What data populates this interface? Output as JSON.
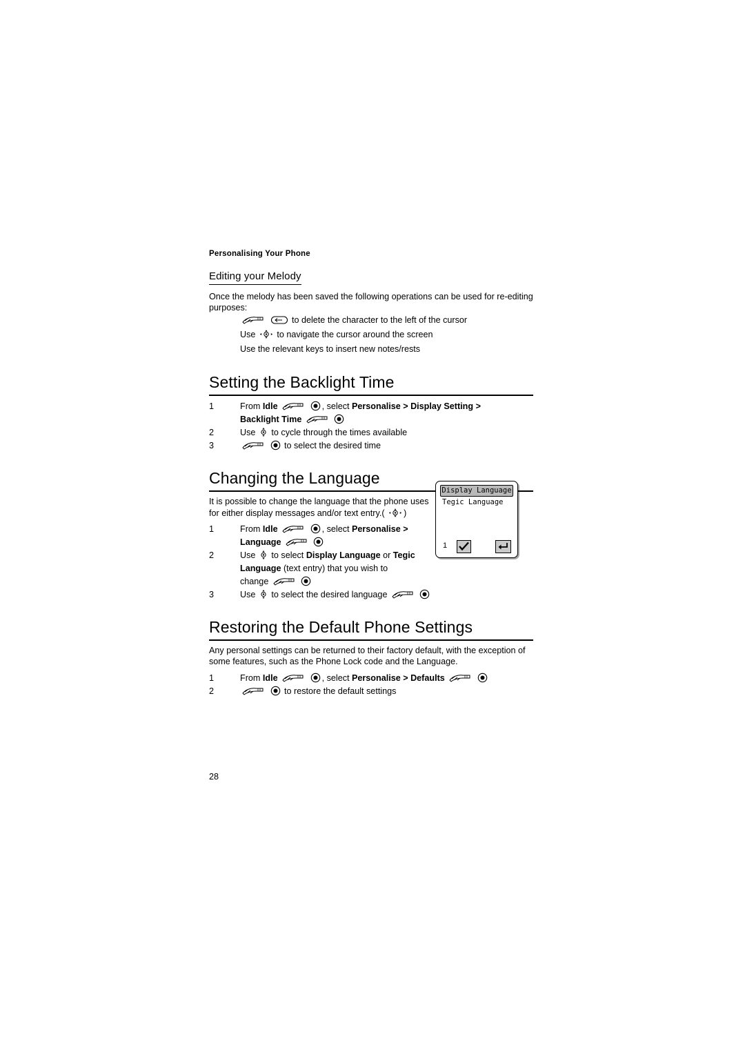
{
  "running_head": "Personalising Your Phone",
  "sections": [
    {
      "id": "editing-melody",
      "heading": "Editing your Melody",
      "intro": "Once the melody has been saved the following operations can be used for re-editing purposes:",
      "lines": [
        "to delete the character to the left of the cursor",
        "Use",
        "to navigate the cursor around the screen",
        "Use the relevant keys to insert new notes/rests"
      ]
    },
    {
      "id": "backlight-time",
      "heading": "Setting the Backlight Time",
      "steps": [
        {
          "num": "1",
          "parts": [
            "From ",
            "Idle",
            ", select ",
            "Personalise",
            " > ",
            "Display Setting",
            " > ",
            "Backlight Time"
          ]
        },
        {
          "num": "2",
          "parts": [
            "Use ",
            "to cycle through the times available"
          ]
        },
        {
          "num": "3",
          "parts": [
            "to select the desired time"
          ]
        }
      ]
    },
    {
      "id": "changing-language",
      "heading": "Changing the Language",
      "intro": "It is possible to change the language that the phone uses for either display messages and/or text entry.(",
      "intro_tail": ")",
      "steps": [
        {
          "num": "1",
          "parts": [
            "From ",
            "Idle",
            ", select ",
            "Personalise",
            " > ",
            "Language"
          ]
        },
        {
          "num": "2",
          "parts": [
            "Use ",
            "to select ",
            "Display Language",
            " or ",
            "Tegic Language",
            " (text entry) that you wish to change"
          ]
        },
        {
          "num": "3",
          "parts": [
            "Use ",
            "to select the desired language"
          ]
        }
      ]
    },
    {
      "id": "restoring-defaults",
      "heading": "Restoring the Default Phone Settings",
      "intro": "Any personal settings can be returned to their factory default, with the exception of some features, such as the Phone Lock code and the Language.",
      "steps": [
        {
          "num": "1",
          "parts": [
            "From ",
            "Idle",
            ", select ",
            "Personalise",
            " > ",
            "Defaults"
          ]
        },
        {
          "num": "2",
          "parts": [
            "to restore the default settings"
          ]
        }
      ]
    }
  ],
  "phone_screen": {
    "title": "Display Language",
    "item": "Tegic Language",
    "index": "1",
    "softkey_left": "check-mark",
    "softkey_right": "back-arrow"
  },
  "page_number": "28",
  "text": {
    "editing_heading": "Editing your Melody",
    "editing_intro": "Once the melody has been saved the following operations can be used for re-editing purposes:",
    "editing_line1": "to delete the character to the left of the cursor",
    "editing_line2_use": "Use",
    "editing_line2_tail": "to navigate the cursor around the screen",
    "editing_line3": "Use the relevant keys to insert new notes/rests",
    "backlight_heading": "Setting the Backlight Time",
    "backlight_s1_from": "From",
    "backlight_s1_idle": "Idle",
    "backlight_s1_select": ", select",
    "backlight_s1_personalise": "Personalise",
    "backlight_s1_gt1": ">",
    "backlight_s1_display": "Display Setting",
    "backlight_s1_gt2": ">",
    "backlight_s1_backlight": "Backlight Time",
    "backlight_s2_use": "Use",
    "backlight_s2_tail": "to cycle through the times available",
    "backlight_s3_tail": "to select the desired time",
    "language_heading": "Changing the Language",
    "language_intro": "It is possible to change the language that the phone uses for either display messages and/or text entry.(",
    "language_intro_close": ")",
    "language_s1_from": "From",
    "language_s1_idle": "Idle",
    "language_s1_select": ", select",
    "language_s1_personalise": "Personalise",
    "language_s1_gt": ">",
    "language_s1_language": "Language",
    "language_s2_use": "Use",
    "language_s2_toselect": "to select",
    "language_s2_display": "Display Language",
    "language_s2_or": "or",
    "language_s2_tegic": "Tegic",
    "language_s2_tegic2": "Language",
    "language_s2_textentry": "(text entry) that you wish to",
    "language_s2_change": "change",
    "language_s3_use": "Use",
    "language_s3_tail": "to select the desired language",
    "defaults_heading": "Restoring the Default Phone Settings",
    "defaults_intro": "Any personal settings can be returned to their factory default, with the exception of some features, such as the Phone Lock code and the Language.",
    "defaults_s1_from": "From",
    "defaults_s1_idle": "Idle",
    "defaults_s1_select": ", select",
    "defaults_s1_personalise": "Personalise",
    "defaults_s1_gt": ">",
    "defaults_s1_defaults": "Defaults",
    "defaults_s2_tail": "to restore the default settings"
  },
  "icons": {
    "softkey": "softkey-press-icon",
    "select": "select-button-icon",
    "clear": "clear-key-icon",
    "nav4": "navigation-4way-icon",
    "navud": "navigation-updown-icon"
  },
  "numbers": {
    "one": "1",
    "two": "2",
    "three": "3"
  }
}
